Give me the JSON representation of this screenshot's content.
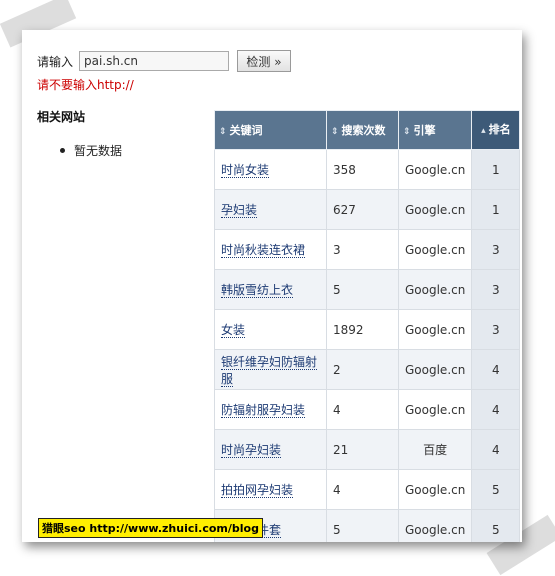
{
  "search": {
    "label": "请输入",
    "value": "pai.sh.cn",
    "button_label": "检测 »",
    "warning": "请不要输入http://"
  },
  "related": {
    "title": "相关网站",
    "items": [
      "暂无数据"
    ]
  },
  "table": {
    "headers": [
      "关键词",
      "搜索次数",
      "引擎",
      "排名"
    ],
    "sort_glyph": "⇕",
    "rank_sort_glyph": "▴",
    "rows": [
      {
        "keyword": "时尚女装",
        "count": "358",
        "engine": "Google.cn",
        "rank": "1"
      },
      {
        "keyword": "孕妇装",
        "count": "627",
        "engine": "Google.cn",
        "rank": "1"
      },
      {
        "keyword": "时尚秋装连衣裙",
        "count": "3",
        "engine": "Google.cn",
        "rank": "3"
      },
      {
        "keyword": "韩版雪纺上衣",
        "count": "5",
        "engine": "Google.cn",
        "rank": "3"
      },
      {
        "keyword": "女装",
        "count": "1892",
        "engine": "Google.cn",
        "rank": "3"
      },
      {
        "keyword": "银纤维孕妇防辐射服",
        "count": "2",
        "engine": "Google.cn",
        "rank": "4"
      },
      {
        "keyword": "防辐射服孕妇装",
        "count": "4",
        "engine": "Google.cn",
        "rank": "4"
      },
      {
        "keyword": "时尚孕妇装",
        "count": "21",
        "engine": "百度",
        "rank": "4"
      },
      {
        "keyword": "拍拍网孕妇装",
        "count": "4",
        "engine": "Google.cn",
        "rank": "5"
      },
      {
        "keyword": "雪纺两件套",
        "count": "5",
        "engine": "Google.cn",
        "rank": "5"
      }
    ]
  },
  "watermark": "猎眼seo http://www.zhuici.com/blog"
}
